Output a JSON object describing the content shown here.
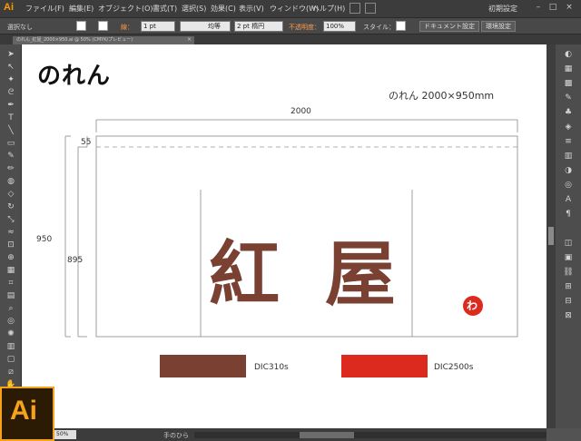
{
  "app": {
    "logo": "Ai",
    "menu": [
      "ファイル(F)",
      "編集(E)",
      "オブジェクト(O)",
      "書式(T)",
      "選択(S)",
      "効果(C)",
      "表示(V)",
      "ウィンドウ(W)",
      "ヘルプ(H)"
    ],
    "workspace": "初期設定",
    "window_buttons": [
      "–",
      "□",
      "×"
    ]
  },
  "control_bar": {
    "selection": "選択なし",
    "stroke_label": "線：",
    "stroke_weight": "1 pt",
    "stroke_profile": "均等",
    "brush": "2 pt 楕円",
    "opacity_label": "不透明度：",
    "opacity": "100%",
    "style_label": "スタイル：",
    "doc_setup": "ドキュメント設定",
    "preferences": "環境設定"
  },
  "document_tab": {
    "name": "のれん_紅屋_2000×950.ai @ 50% (CMYK/プレビュー)",
    "close": "×"
  },
  "artboard": {
    "title": "のれん",
    "spec": "のれん 2000×950mm",
    "dim_width": "2000",
    "dim_height_total": "950",
    "dim_height_inner": "895",
    "dim_top": "55",
    "calligraphy": [
      "紅",
      "屋"
    ],
    "logo_mark": "わ",
    "swatches": [
      {
        "name": "DIC310s",
        "color": "#7a4032"
      },
      {
        "name": "DIC2500s",
        "color": "#dc2b1e"
      }
    ]
  },
  "status": {
    "zoom": "50%",
    "tool": "手のひら"
  },
  "badge": "Ai",
  "colors": {
    "accent": "#f7a21b",
    "brown": "#7a4032",
    "red": "#dc2b1e"
  }
}
